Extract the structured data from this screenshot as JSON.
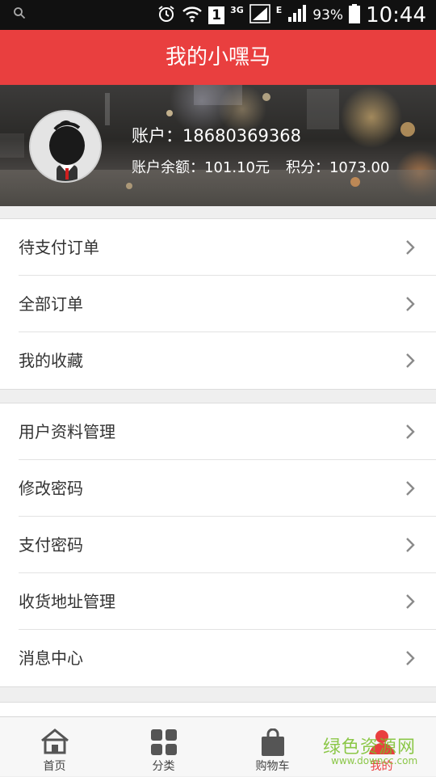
{
  "status_bar": {
    "battery": "93%",
    "time": "10:44",
    "sim_badge": "1",
    "network_3g": "3G",
    "network_e": "E",
    "icons": [
      "search-icon",
      "alarm-icon",
      "wifi-icon",
      "signal-icon",
      "battery-icon"
    ]
  },
  "header": {
    "title": "我的小嘿马"
  },
  "profile": {
    "account": "账户：18680369368",
    "balance": "账户余额：101.10元",
    "points": "积分：1073.00"
  },
  "menu_groups": [
    {
      "items": [
        {
          "label": "待支付订单"
        },
        {
          "label": "全部订单"
        },
        {
          "label": "我的收藏"
        }
      ]
    },
    {
      "items": [
        {
          "label": "用户资料管理"
        },
        {
          "label": "修改密码"
        },
        {
          "label": "支付密码"
        },
        {
          "label": "收货地址管理"
        },
        {
          "label": "消息中心"
        }
      ]
    }
  ],
  "tabbar": {
    "tabs": [
      {
        "label": "首页",
        "icon": "home-icon"
      },
      {
        "label": "分类",
        "icon": "category-icon"
      },
      {
        "label": "购物车",
        "icon": "cart-icon"
      },
      {
        "label": "我的",
        "icon": "user-icon",
        "active": true
      }
    ],
    "active_color": "#e93f3f"
  },
  "watermark": {
    "main": "绿色资源网",
    "sub": "www.downcc.com"
  },
  "colors": {
    "brand": "#e93f3f",
    "background": "#efefef"
  }
}
